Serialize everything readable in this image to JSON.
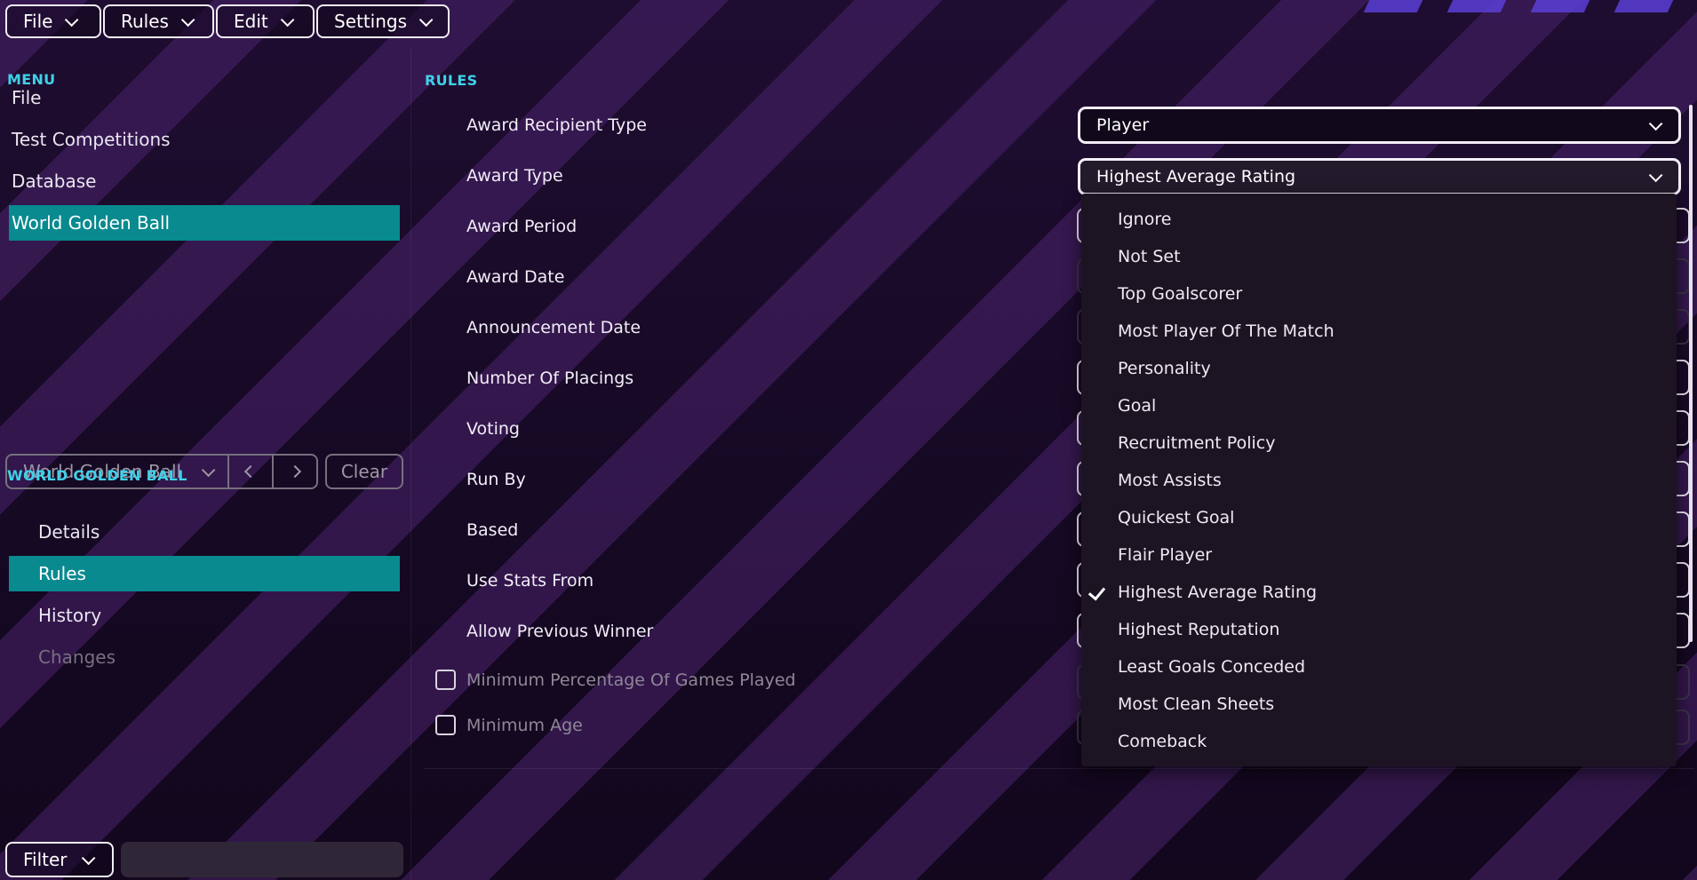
{
  "top_menu": {
    "file": "File",
    "rules": "Rules",
    "edit": "Edit",
    "settings": "Settings"
  },
  "menu": {
    "heading": "MENU",
    "items": [
      {
        "label": "File",
        "active": false
      },
      {
        "label": "Test Competitions",
        "active": false
      },
      {
        "label": "Database",
        "active": false
      },
      {
        "label": "World Golden Ball",
        "active": true
      }
    ]
  },
  "picker": {
    "selected": "World Golden Ball",
    "clear_label": "Clear"
  },
  "competition": {
    "heading": "WORLD GOLDEN BALL",
    "items": [
      {
        "label": "Details",
        "state": "normal"
      },
      {
        "label": "Rules",
        "state": "active"
      },
      {
        "label": "History",
        "state": "normal"
      },
      {
        "label": "Changes",
        "state": "disabled"
      }
    ]
  },
  "filter": {
    "label": "Filter",
    "value": ""
  },
  "rules": {
    "heading": "RULES",
    "fields": [
      "Award Recipient Type",
      "Award Type",
      "Award Period",
      "Award Date",
      "Announcement Date",
      "Number Of Placings",
      "Voting",
      "Run By",
      "Based",
      "Use Stats From",
      "Allow Previous Winner"
    ],
    "checkbox_fields": [
      {
        "label": "Minimum Percentage Of Games Played",
        "checked": false
      },
      {
        "label": "Minimum Age",
        "checked": false
      }
    ],
    "award_recipient_type_value": "Player",
    "award_type_value": "Highest Average Rating"
  },
  "award_type_options": {
    "selected": "Highest Average Rating",
    "options": [
      "Ignore",
      "Not Set",
      "Top Goalscorer",
      "Most Player Of The Match",
      "Personality",
      "Goal",
      "Recruitment Policy",
      "Most Assists",
      "Quickest Goal",
      "Flair Player",
      "Highest Average Rating",
      "Highest Reputation",
      "Least Goals Conceded",
      "Most Clean Sheets",
      "Comeback"
    ]
  },
  "colors": {
    "accent_teal": "#088a8f",
    "heading_cyan": "#3fd1e8",
    "background": "#1a0b26"
  }
}
